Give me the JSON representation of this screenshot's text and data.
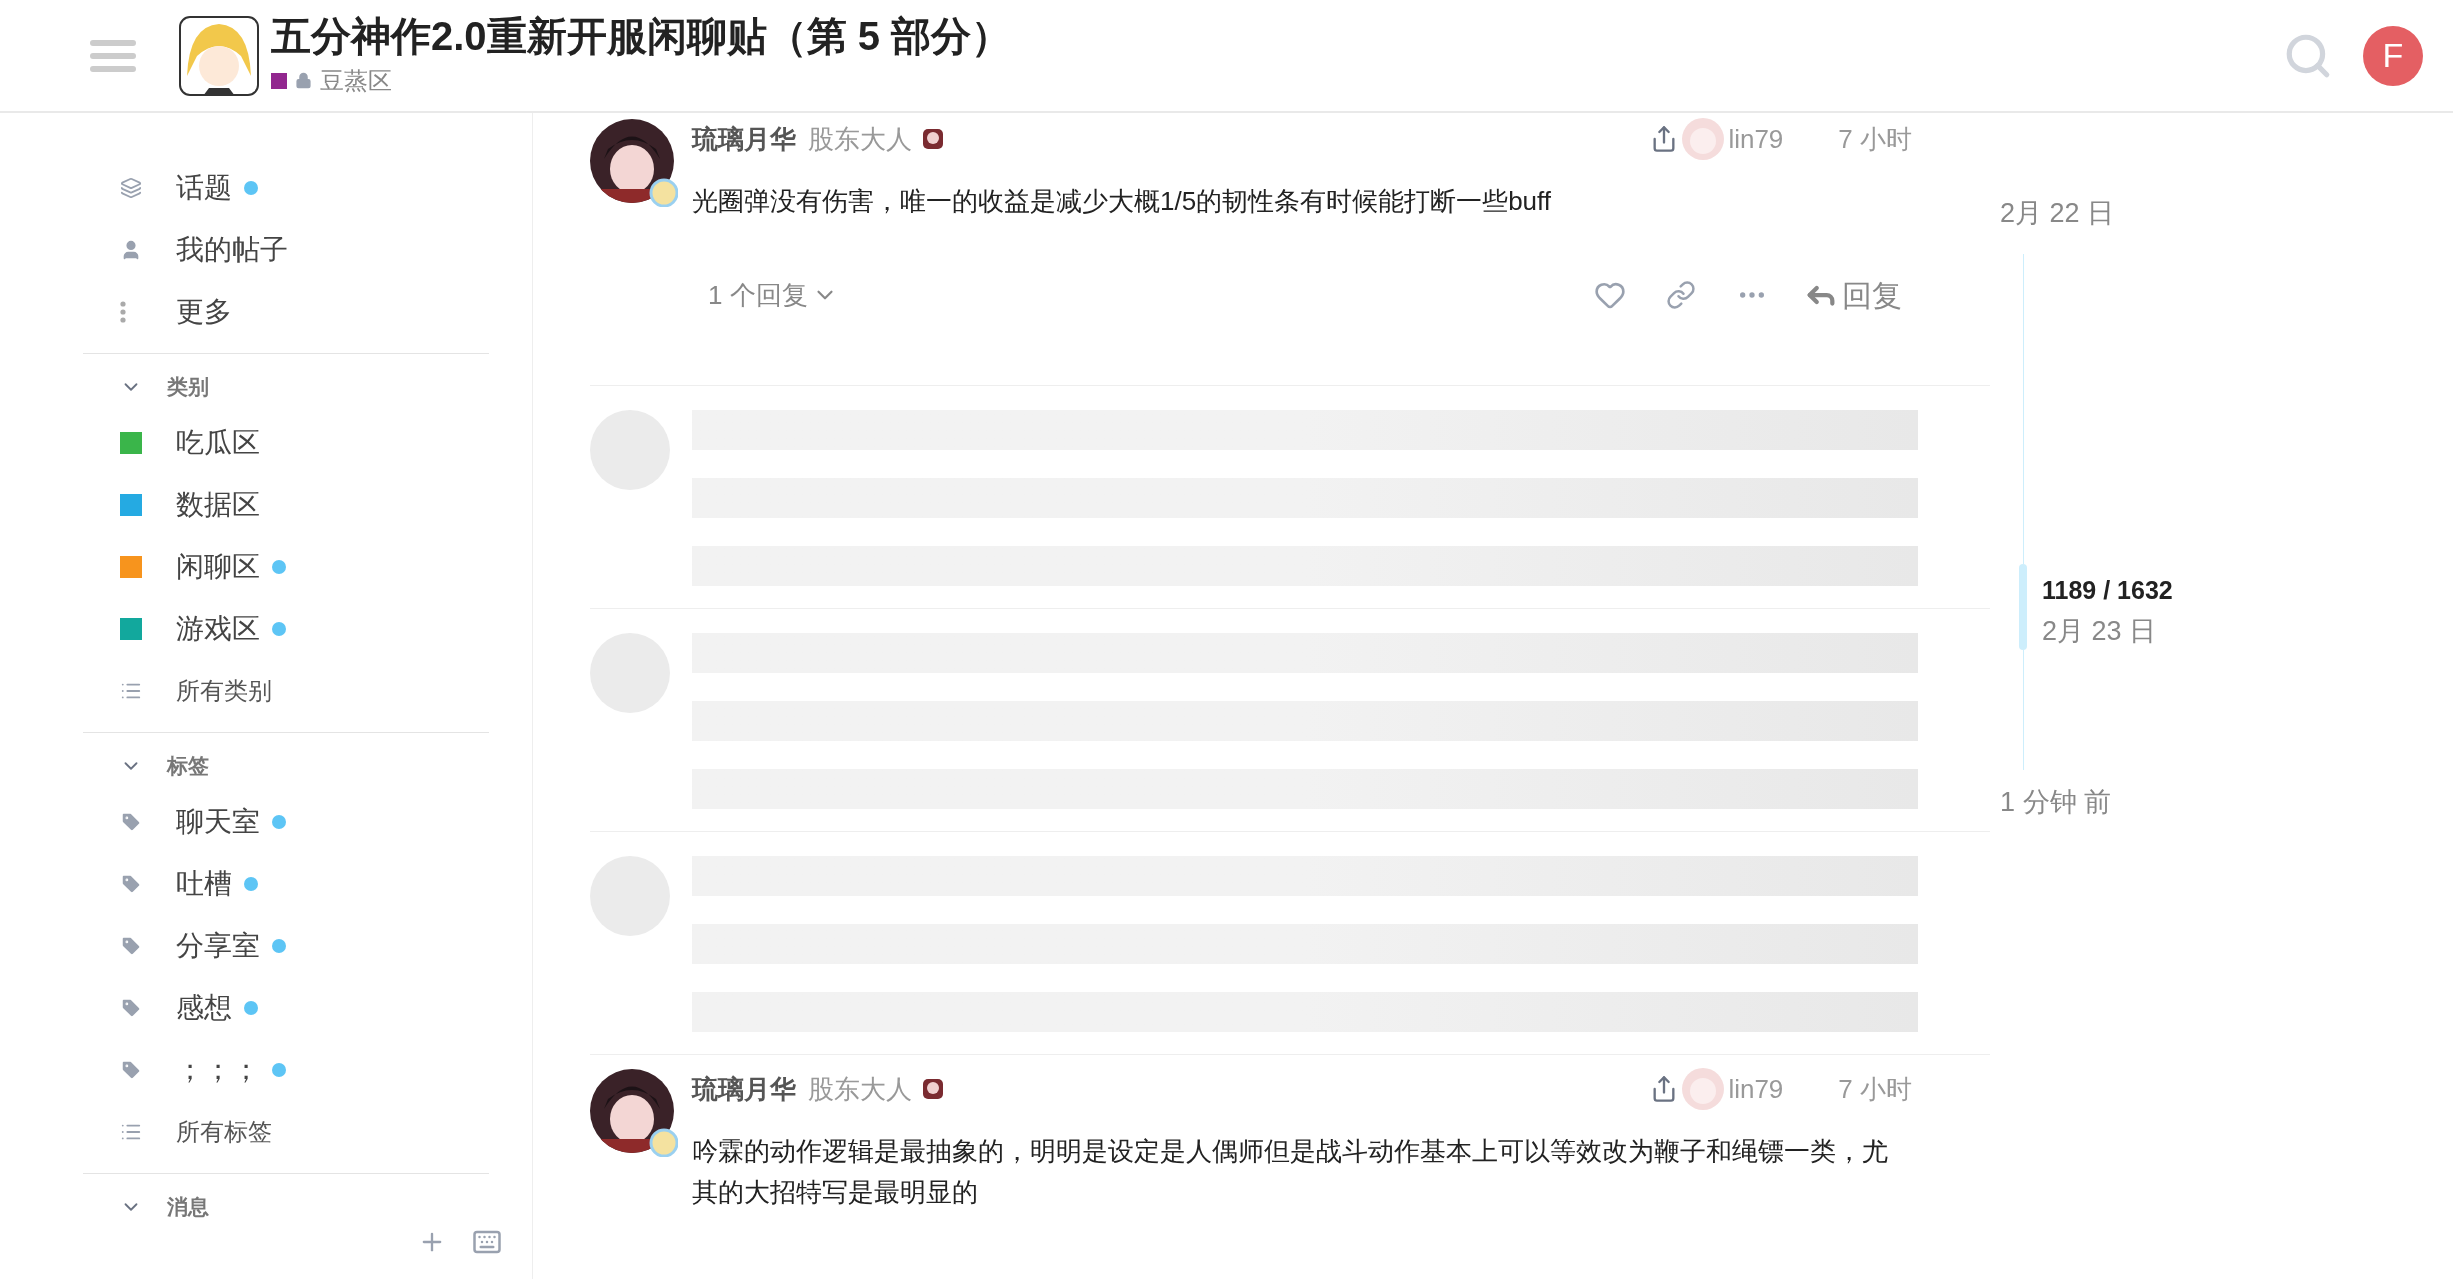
{
  "header": {
    "title": "五分神作2.0重新开服闲聊贴（第 5 部分）",
    "category": {
      "name": "豆蒸区",
      "color": "#92278f"
    }
  },
  "user_avatar": {
    "letter": "F",
    "color": "#e45f63"
  },
  "sidebar": {
    "nav": [
      {
        "kind": "layers",
        "label": "话题",
        "unread": true
      },
      {
        "kind": "user",
        "label": "我的帖子",
        "unread": false
      },
      {
        "kind": "more",
        "label": "更多",
        "unread": false
      }
    ],
    "sections": [
      {
        "title": "类别",
        "expanded": true,
        "items": [
          {
            "kind": "category",
            "label": "吃瓜区",
            "color": "#3ab54a",
            "unread": false
          },
          {
            "kind": "category",
            "label": "数据区",
            "color": "#25aae2",
            "unread": false
          },
          {
            "kind": "category",
            "label": "闲聊区",
            "color": "#f7941d",
            "unread": true
          },
          {
            "kind": "category",
            "label": "游戏区",
            "color": "#12a89d",
            "unread": true
          },
          {
            "kind": "all",
            "label": "所有类别",
            "unread": false
          }
        ]
      },
      {
        "title": "标签",
        "expanded": true,
        "items": [
          {
            "kind": "tag",
            "label": "聊天室",
            "unread": true
          },
          {
            "kind": "tag",
            "label": "吐槽",
            "unread": true
          },
          {
            "kind": "tag",
            "label": "分享室",
            "unread": true
          },
          {
            "kind": "tag",
            "label": "感想",
            "unread": true
          },
          {
            "kind": "tag",
            "label": "；；；",
            "unread": true
          },
          {
            "kind": "all",
            "label": "所有标签",
            "unread": false
          }
        ]
      },
      {
        "title": "消息",
        "expanded": true
      }
    ]
  },
  "posts": [
    {
      "author": "琉璃月华",
      "title": "股东大人",
      "reply_to": "lin79",
      "time": "7 小时",
      "body": "光圈弹没有伤害，唯一的收益是减少大概1/5的韧性条有时候能打断一些buff",
      "replies": "1 个回复",
      "reply_button": "回复",
      "show_actions": true,
      "loading_after": true
    },
    {
      "author": "琉璃月华",
      "title": "股东大人",
      "reply_to": "lin79",
      "time": "7 小时",
      "body": "吟霖的动作逻辑是最抽象的，明明是设定是人偶师但是战斗动作基本上可以等效改为鞭子和绳镖一类，尤其的大招特写是最明显的",
      "show_actions": false,
      "loading_after": false
    }
  ],
  "timeline": {
    "start": "2月 22 日",
    "position": "1189 / 1632",
    "current_date": "2月 23 日",
    "end": "1 分钟 前"
  }
}
